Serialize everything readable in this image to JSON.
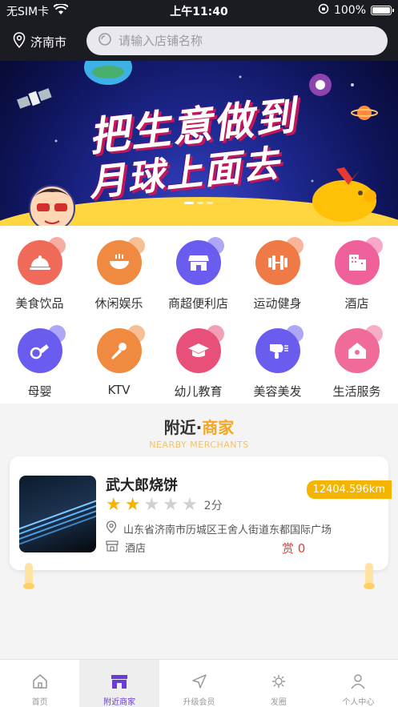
{
  "status_bar": {
    "carrier": "无SIM卡",
    "time": "上午11:40",
    "battery": "100%"
  },
  "header": {
    "city": "济南市",
    "search_placeholder": "请输入店铺名称"
  },
  "banner": {
    "line1": "把生意做到",
    "line2": "月球上面去"
  },
  "categories": [
    {
      "label": "美食饮品",
      "icon": "cloche-icon",
      "color": "#f06a5a"
    },
    {
      "label": "休闲娱乐",
      "icon": "bowl-icon",
      "color": "#f08a40"
    },
    {
      "label": "商超便利店",
      "icon": "store-icon",
      "color": "#6b5cf0"
    },
    {
      "label": "运动健身",
      "icon": "dumbbell-icon",
      "color": "#f07a45"
    },
    {
      "label": "酒店",
      "icon": "hotel-icon",
      "color": "#f0609a"
    },
    {
      "label": "母婴",
      "icon": "pacifier-icon",
      "color": "#6b5cf0"
    },
    {
      "label": "KTV",
      "icon": "microphone-icon",
      "color": "#f08a40"
    },
    {
      "label": "幼儿教育",
      "icon": "graduation-cap-icon",
      "color": "#e8507a"
    },
    {
      "label": "美容美发",
      "icon": "hair-dryer-icon",
      "color": "#6b5cf0"
    },
    {
      "label": "生活服务",
      "icon": "house-icon",
      "color": "#f06a9a"
    }
  ],
  "section": {
    "title_prefix": "附近·",
    "title_accent": "商家",
    "subtitle": "NEARBY MERCHANTS"
  },
  "merchant": {
    "name": "武大郎烧饼",
    "rating": 2,
    "max_rating": 5,
    "score_text": "2分",
    "address": "山东省济南市历城区王舍人街道东都国际广场",
    "type": "酒店",
    "reward": "赏 0",
    "distance": "12404.596km"
  },
  "colors": {
    "accent": "#f5b400",
    "active_tab": "#6a3cd6",
    "reward": "#e53935"
  },
  "tabbar": {
    "items": [
      {
        "label": "首页",
        "icon": "home-icon"
      },
      {
        "label": "附近商家",
        "icon": "shop-icon",
        "active": true
      },
      {
        "label": "升级会员",
        "icon": "send-icon"
      },
      {
        "label": "发圈",
        "icon": "share-icon"
      },
      {
        "label": "个人中心",
        "icon": "user-icon"
      }
    ]
  }
}
